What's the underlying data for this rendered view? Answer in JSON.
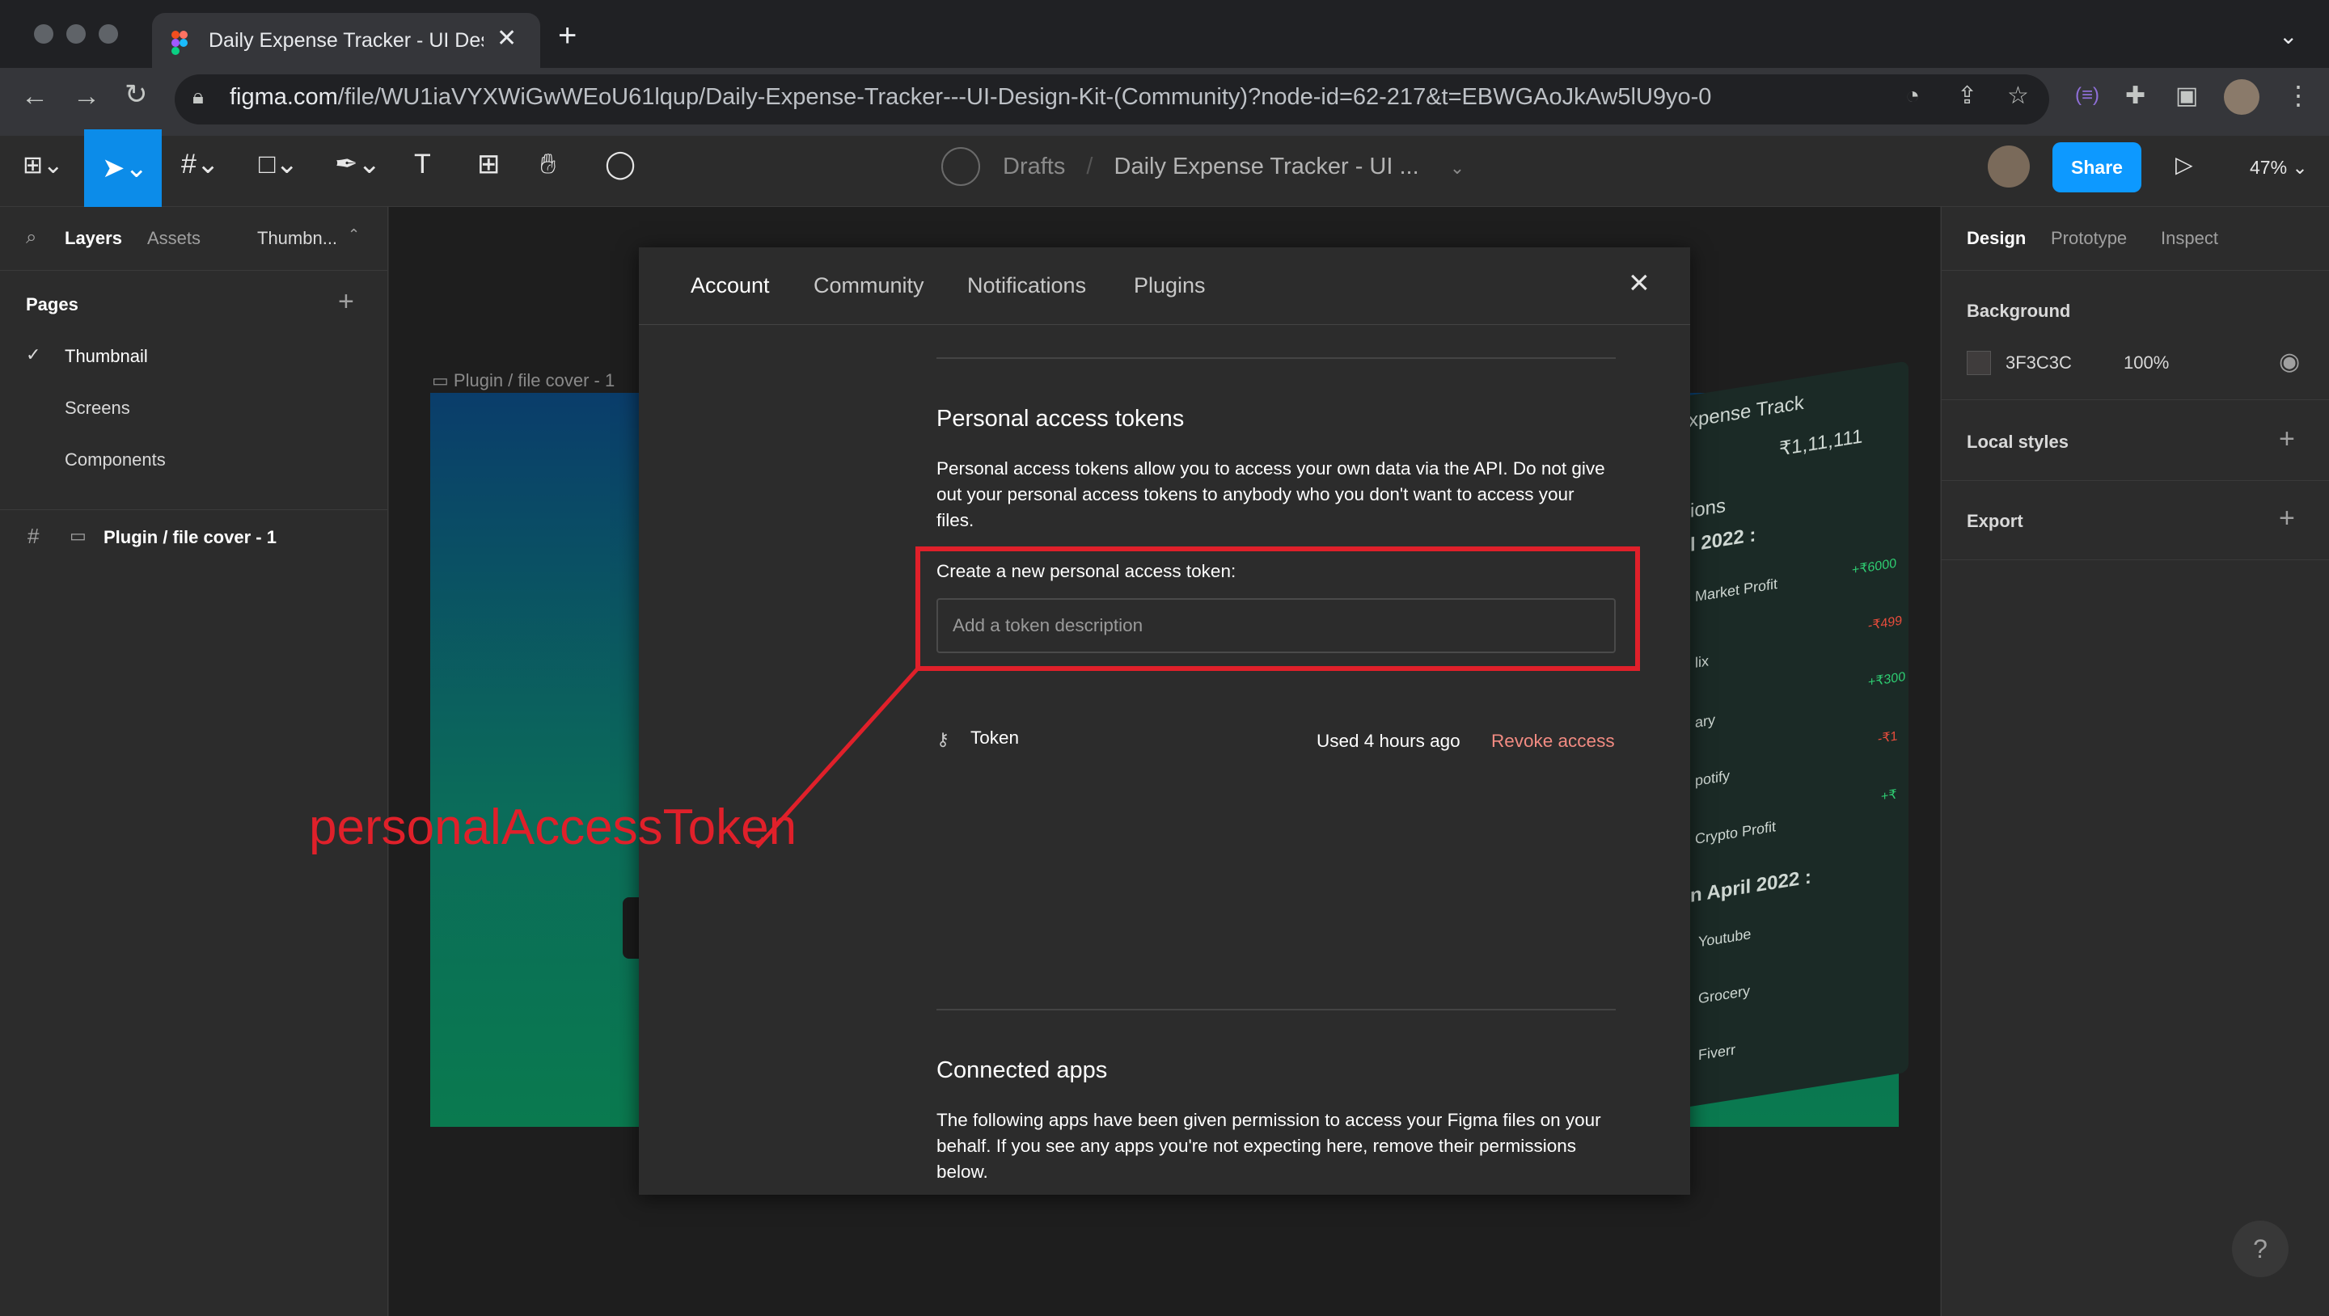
{
  "browser": {
    "tab_title": "Daily Expense Tracker - UI Des",
    "url_host": "figma.com",
    "url_path": "/file/WU1iaVYXWiGwWEoU61lqup/Daily-Expense-Tracker---UI-Design-Kit-(Community)?node-id=62-217&t=EBWGAoJkAw5lU9yo-0"
  },
  "figma_toolbar": {
    "breadcrumb_parent": "Drafts",
    "breadcrumb_doc": "Daily Expense Tracker - UI ...",
    "share_label": "Share",
    "zoom": "47%"
  },
  "left_panel": {
    "tabs": [
      "Layers",
      "Assets",
      "Thumbn..."
    ],
    "pages_heading": "Pages",
    "pages": [
      "Thumbnail",
      "Screens",
      "Components"
    ],
    "layer": "Plugin / file cover - 1"
  },
  "right_panel": {
    "tabs": [
      "Design",
      "Prototype",
      "Inspect"
    ],
    "background_label": "Background",
    "background_hex": "3F3C3C",
    "background_opacity": "100%",
    "local_styles": "Local styles",
    "export": "Export"
  },
  "canvas": {
    "frame_label": "Plugin / file cover - 1",
    "phone_texts": [
      "xpense Track",
      "₹1,11,111",
      "ions",
      "l 2022 :",
      "Market Profit",
      "+₹6000",
      "-₹499",
      "lix",
      "+₹300",
      "ary",
      "-₹1",
      "potify",
      "+₹",
      "Crypto Profit",
      "n April 2022 :",
      "Youtube",
      "Grocery",
      "Fiverr"
    ]
  },
  "modal": {
    "tabs": [
      "Account",
      "Community",
      "Notifications",
      "Plugins"
    ],
    "pat_heading": "Personal access tokens",
    "pat_desc": "Personal access tokens allow you to access your own data via the API. Do not give out your personal access tokens to anybody who you don't want to access your files.",
    "create_label": "Create a new personal access token:",
    "token_placeholder": "Add a token description",
    "token_name": "Token",
    "token_used": "Used 4 hours ago",
    "revoke_label": "Revoke access",
    "apps_heading": "Connected apps",
    "apps_desc": "The following apps have been given permission to access your Figma files on your behalf. If you see any apps you're not expecting here, remove their permissions below."
  },
  "annotation": {
    "label": "personalAccessToken",
    "color": "#e0202a"
  },
  "help_label": "?"
}
